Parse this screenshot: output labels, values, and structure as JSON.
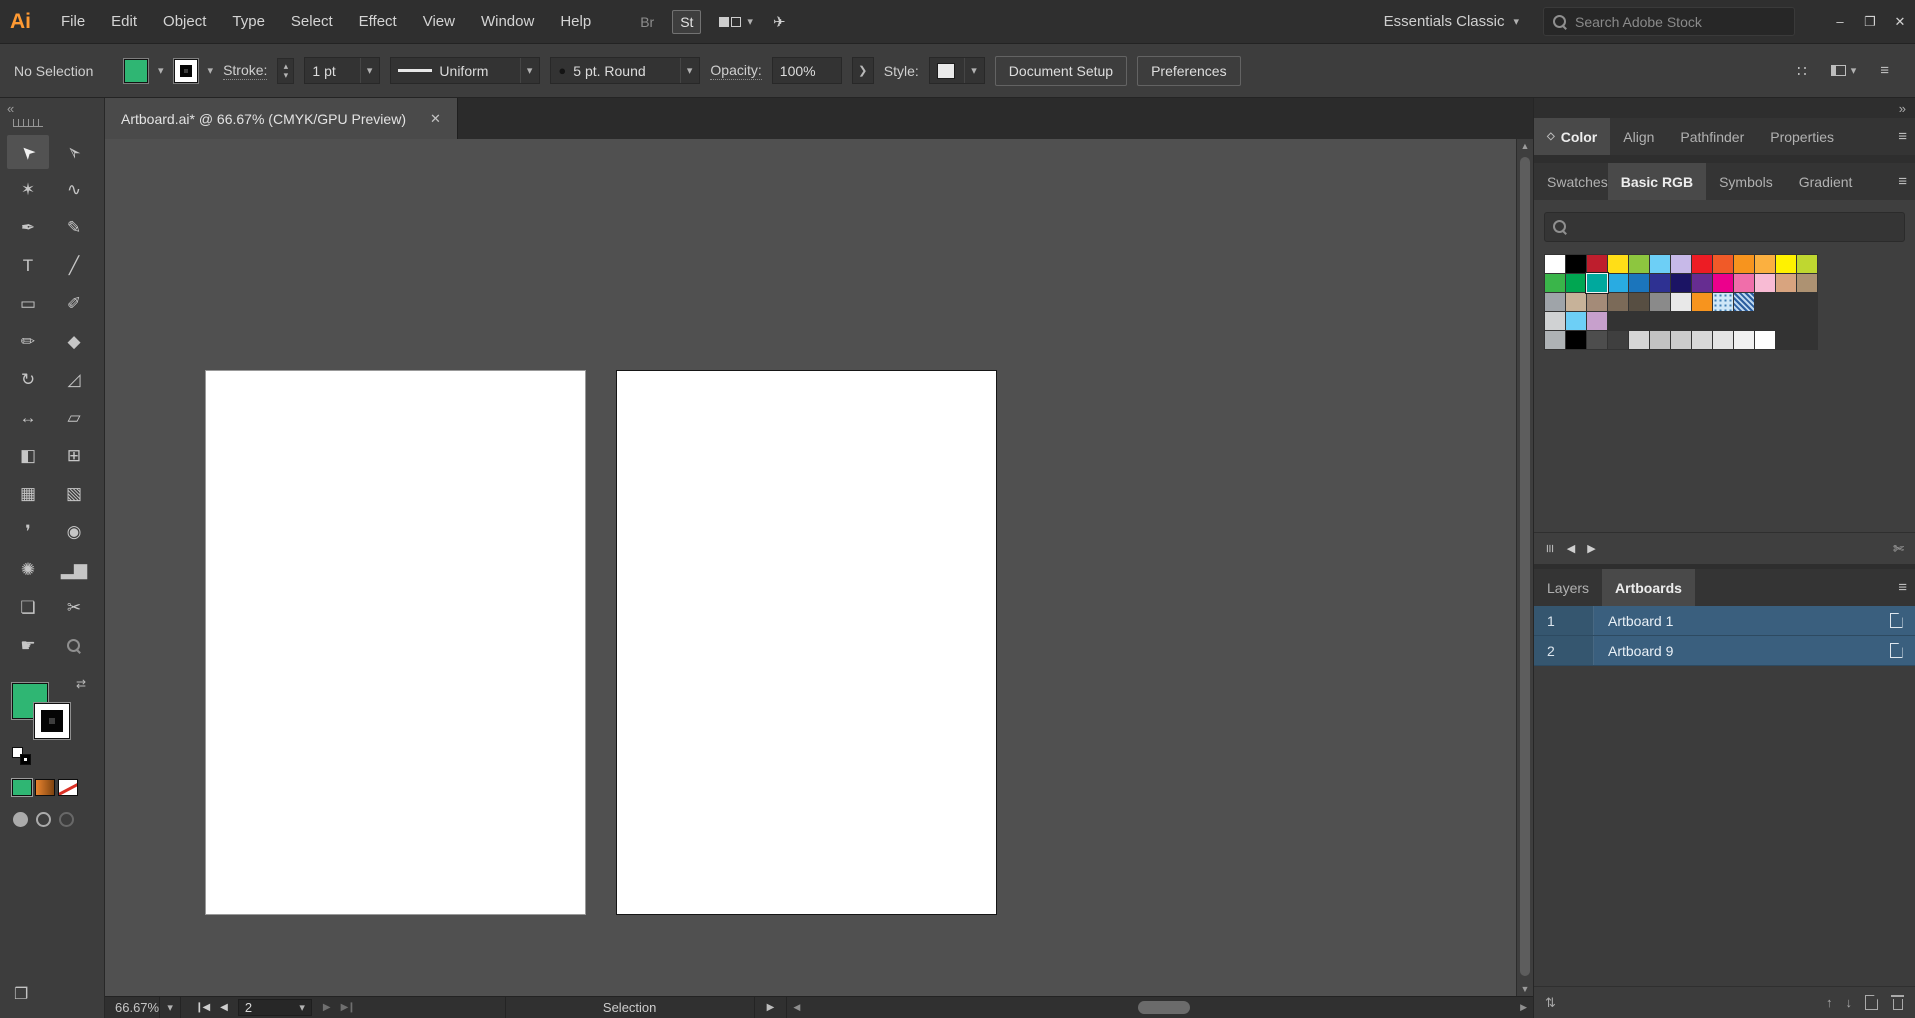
{
  "window": {
    "minimize": "–",
    "restore": "❐",
    "close": "✕"
  },
  "icons": {
    "caret_down": "▾",
    "chevron_right": "❯",
    "collapse_left": "«",
    "collapse_right": "»",
    "menu": "≡",
    "swap": "⇄",
    "share": "✈",
    "stepper_up": "▴",
    "stepper_down": "▾",
    "brush_dot": "●",
    "grid_dots": "∷",
    "arrow_up": "▲",
    "arrow_down": "▼",
    "nav_first": "❙◀",
    "nav_prev": "◀",
    "nav_next": "▶",
    "nav_last": "▶❙",
    "play": "▶",
    "small_left": "◀",
    "small_right": "▶",
    "scissors": "✄",
    "rearrange": "⇅",
    "move_up": "↑",
    "move_down": "↓",
    "diamond": "◇"
  },
  "colors": {
    "fill": "#2FB673",
    "gradient": "#E8832E",
    "none_slash": "#D93025",
    "artboard_selection": "#3A5F7E"
  },
  "menu_bar": {
    "logo": "Ai",
    "menus": [
      "File",
      "Edit",
      "Object",
      "Type",
      "Select",
      "Effect",
      "View",
      "Window",
      "Help"
    ],
    "bridge_label": "Br",
    "stock_label": "St",
    "workspace_label": "Essentials Classic",
    "search_placeholder": "Search Adobe Stock"
  },
  "control_bar": {
    "selection_status": "No Selection",
    "stroke_label": "Stroke:",
    "stroke_weight": "1 pt",
    "profile_label": "Uniform",
    "brush_label": "5 pt. Round",
    "opacity_label": "Opacity:",
    "opacity_value": "100%",
    "style_label": "Style:",
    "document_setup_label": "Document Setup",
    "preferences_label": "Preferences"
  },
  "toolbar": {
    "tools": [
      {
        "name": "selection",
        "glyph": "➤",
        "rot": -135,
        "active": true
      },
      {
        "name": "direct-selection",
        "glyph": "➢",
        "rot": -135
      },
      {
        "name": "magic-wand",
        "glyph": "✶"
      },
      {
        "name": "lasso",
        "glyph": "∿"
      },
      {
        "name": "pen",
        "glyph": "✒"
      },
      {
        "name": "curvature",
        "glyph": "✎"
      },
      {
        "name": "type",
        "glyph": "T"
      },
      {
        "name": "line-segment",
        "glyph": "╱"
      },
      {
        "name": "rectangle",
        "glyph": "▭"
      },
      {
        "name": "paintbrush",
        "glyph": "✐"
      },
      {
        "name": "shaper",
        "glyph": "✏"
      },
      {
        "name": "eraser",
        "glyph": "◆"
      },
      {
        "name": "rotate",
        "glyph": "↻"
      },
      {
        "name": "scale",
        "glyph": "◿"
      },
      {
        "name": "width",
        "glyph": "↔"
      },
      {
        "name": "free-transform",
        "glyph": "▱"
      },
      {
        "name": "shape-builder",
        "glyph": "◧"
      },
      {
        "name": "perspective-grid",
        "glyph": "⊞"
      },
      {
        "name": "mesh",
        "glyph": "▦"
      },
      {
        "name": "gradient",
        "glyph": "▧"
      },
      {
        "name": "eyedropper",
        "glyph": "❜"
      },
      {
        "name": "blend",
        "glyph": "◉"
      },
      {
        "name": "symbol-sprayer",
        "glyph": "✺"
      },
      {
        "name": "column-graph",
        "glyph": "▂▆"
      },
      {
        "name": "artboard",
        "glyph": "❏"
      },
      {
        "name": "slice",
        "glyph": "✂"
      },
      {
        "name": "hand",
        "glyph": "☛"
      },
      {
        "name": "zoom",
        "glyph": "",
        "mag": true
      }
    ]
  },
  "document": {
    "tab_title": "Artboard.ai* @ 66.67% (CMYK/GPU Preview)"
  },
  "right_dock": {
    "panel_tabs_top": [
      "Color",
      "Align",
      "Pathfinder",
      "Properties"
    ],
    "swatch_panel": {
      "tabs": [
        "Swatches",
        "Basic RGB",
        "Symbols",
        "Gradient"
      ],
      "active_tab": "Basic RGB",
      "rows": [
        [
          {
            "color": "#FFFFFF"
          },
          {
            "color": "#000000"
          },
          {
            "color": "#BE1E2D"
          },
          {
            "color": "#FFDE17"
          },
          {
            "color": "#8DC63F"
          },
          {
            "color": "#6DCFF6"
          },
          {
            "color": "#C7B9E8"
          },
          {
            "color": "#ED1C24"
          },
          {
            "color": "#F05A28"
          },
          {
            "color": "#F7941E"
          },
          {
            "color": "#FBB040"
          },
          {
            "color": "#FFF200"
          },
          {
            "color": "#BFD730"
          }
        ],
        [
          {
            "color": "#3AB54A"
          },
          {
            "color": "#00A651"
          },
          {
            "color": "#00A99D",
            "selected": true
          },
          {
            "color": "#29ABE2"
          },
          {
            "color": "#1B75BC"
          },
          {
            "color": "#2E3192"
          },
          {
            "color": "#1B1464"
          },
          {
            "color": "#662D91"
          },
          {
            "color": "#EC008C"
          },
          {
            "color": "#F06EAA"
          },
          {
            "color": "#F8BBD4"
          },
          {
            "color": "#D8A47F"
          },
          {
            "color": "#AD9272"
          }
        ],
        [
          {
            "color": "#9FA4A9"
          },
          {
            "color": "#C7B299"
          },
          {
            "color": "#A48B78"
          },
          {
            "color": "#7B6A58"
          },
          {
            "color": "#574E42"
          },
          {
            "color": "#8A8A8A"
          },
          {
            "color": "#E8E8E8"
          },
          {
            "color": "#F7941E"
          },
          {
            "pattern": "dots"
          },
          {
            "pattern": "hatch"
          }
        ],
        [
          {
            "color": "#D0D2D3"
          },
          {
            "color": "#6DCFF6"
          },
          {
            "color": "#C7A0CC"
          }
        ],
        [
          {
            "color": "#AEB2B5"
          },
          {
            "color": "#000000"
          },
          {
            "color": "#4D4D4D"
          },
          {
            "gap": true
          },
          {
            "color": "#D6D6D6"
          },
          {
            "color": "#C2C2C2"
          },
          {
            "color": "#CCCCCC"
          },
          {
            "color": "#D8D8D8"
          },
          {
            "color": "#E4E4E4"
          },
          {
            "color": "#F1F1F1"
          },
          {
            "color": "#FFFFFF"
          }
        ]
      ]
    },
    "layers_panel": {
      "tabs": [
        "Layers",
        "Artboards"
      ],
      "active_tab": "Artboards",
      "artboards": [
        {
          "number": "1",
          "name": "Artboard 1"
        },
        {
          "number": "2",
          "name": "Artboard 9"
        }
      ]
    }
  },
  "status_bar": {
    "zoom": "66.67%",
    "artboard_number": "2",
    "tool_status": "Selection"
  }
}
